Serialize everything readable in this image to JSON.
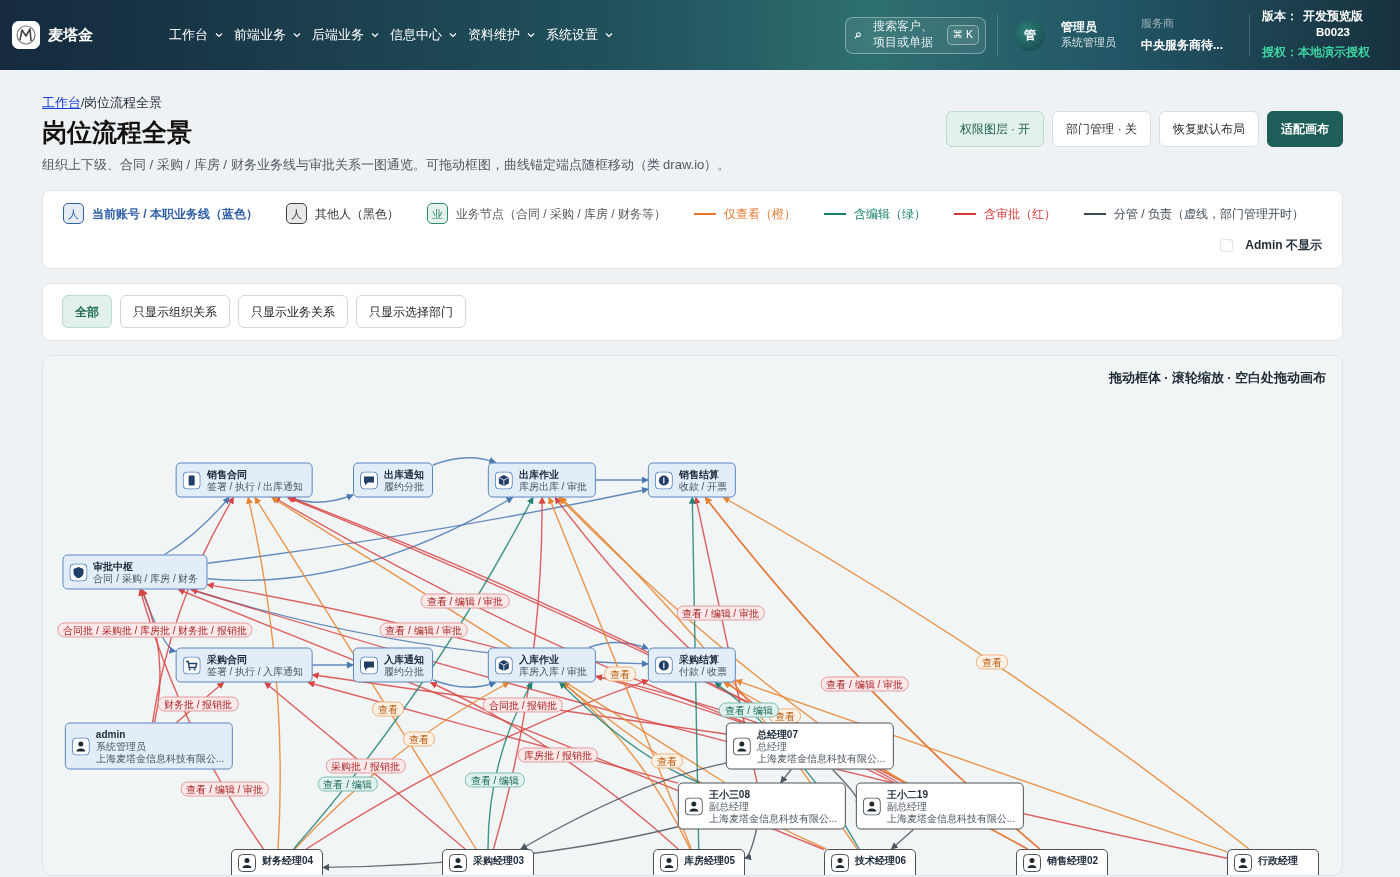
{
  "header": {
    "brand": "麦塔金",
    "nav": [
      {
        "label": "工作台"
      },
      {
        "label": "前端业务"
      },
      {
        "label": "后端业务"
      },
      {
        "label": "信息中心"
      },
      {
        "label": "资料维护"
      },
      {
        "label": "系统设置"
      }
    ],
    "search": {
      "placeholder": "搜索客户、项目或单据",
      "shortcut": "⌘ K"
    },
    "user": {
      "avatar": "管",
      "name": "管理员",
      "role": "系统管理员"
    },
    "provider": {
      "label": "服务商",
      "value": "中央服务商待..."
    },
    "version": {
      "label": "版本：",
      "value": "开发预览版 B0023"
    },
    "license": {
      "label": "授权：",
      "value": "本地演示授权"
    }
  },
  "page": {
    "breadcrumb": [
      {
        "label": "工作台",
        "link": true
      },
      {
        "label": "岗位流程全景",
        "link": false
      }
    ],
    "separator": "/",
    "title": "岗位流程全景",
    "description": "组织上下级、合同 / 采购 / 库房 / 财务业务线与审批关系一图通览。可拖动框图，曲线锚定端点随框移动（类 draw.io）。",
    "actions": [
      {
        "label": "权限图层 · 开",
        "kind": "soft"
      },
      {
        "label": "部门管理 · 关",
        "kind": "outline"
      },
      {
        "label": "恢复默认布局",
        "kind": "outline"
      },
      {
        "label": "适配画布",
        "kind": "primary"
      }
    ]
  },
  "legend": {
    "items": [
      {
        "kind": "chip",
        "icon": "人",
        "label": "当前账号 / 本职业务线（蓝色）",
        "color": "#2f5fa7"
      },
      {
        "kind": "chip",
        "icon": "人",
        "label": "其他人（黑色）",
        "color": "#3a3f45"
      },
      {
        "kind": "chip",
        "icon": "业",
        "label": "业务节点（合同 / 采购 / 库房 / 财务等）",
        "color": "#2a8a6e"
      },
      {
        "kind": "line",
        "label": "仅查看（橙）",
        "color": "#e8762c"
      },
      {
        "kind": "line",
        "label": "含编辑（绿）",
        "color": "#17806a"
      },
      {
        "kind": "line",
        "label": "含审批（红）",
        "color": "#d93636"
      },
      {
        "kind": "line",
        "label": "分管 / 负责（虚线，部门管理开时）",
        "color": "#3d4a55"
      }
    ],
    "admin_toggle": {
      "label": "Admin 不显示",
      "checked": false
    }
  },
  "filters": [
    {
      "label": "全部",
      "selected": true
    },
    {
      "label": "只显示组织关系",
      "selected": false
    },
    {
      "label": "只显示业务关系",
      "selected": false
    },
    {
      "label": "只显示选择部门",
      "selected": false
    }
  ],
  "canvas": {
    "hint": "拖动框体 · 滚轮缩放 · 空白处拖动画布",
    "nodes": [
      {
        "kind": "sales",
        "title": "销售合同",
        "lines": [
          "签署 / 执行 / 出库通知"
        ]
      },
      {
        "kind": "notice",
        "title": "出库通知",
        "lines": [
          "履约分批"
        ]
      },
      {
        "kind": "stock",
        "title": "出库作业",
        "lines": [
          "库房出库 / 审批"
        ]
      },
      {
        "kind": "settlement",
        "title": "销售结算",
        "lines": [
          "收款 / 开票"
        ]
      },
      {
        "kind": "hub",
        "title": "审批中枢",
        "lines": [
          "合同 / 采购 / 库房 / 财务"
        ]
      },
      {
        "kind": "purchase",
        "title": "采购合同",
        "lines": [
          "签署 / 执行 / 入库通知"
        ]
      },
      {
        "kind": "notice",
        "title": "入库通知",
        "lines": [
          "履约分批"
        ]
      },
      {
        "kind": "stock",
        "title": "入库作业",
        "lines": [
          "库房入库 / 审批"
        ]
      },
      {
        "kind": "settlement",
        "title": "采购结算",
        "lines": [
          "付款 / 收票"
        ]
      },
      {
        "kind": "self",
        "title": "admin",
        "lines": [
          "系统管理员",
          "上海麦塔金信息科技有限公..."
        ]
      },
      {
        "kind": "person",
        "title": "总经理07",
        "lines": [
          "总经理",
          "上海麦塔金信息科技有限公..."
        ]
      },
      {
        "kind": "person",
        "title": "王小三08",
        "lines": [
          "副总经理",
          "上海麦塔金信息科技有限公..."
        ]
      },
      {
        "kind": "person",
        "title": "王小二19",
        "lines": [
          "副总经理",
          "上海麦塔金信息科技有限公..."
        ]
      },
      {
        "kind": "person",
        "title": "财务经理04"
      },
      {
        "kind": "person",
        "title": "采购经理03"
      },
      {
        "kind": "person",
        "title": "库房经理05"
      },
      {
        "kind": "person",
        "title": "技术经理06"
      },
      {
        "kind": "person",
        "title": "销售经理02"
      },
      {
        "kind": "person",
        "title": "行政经理"
      }
    ],
    "edges": [
      {
        "kind": "org"
      },
      {
        "kind": "org"
      },
      {
        "kind": "org"
      },
      {
        "kind": "org"
      },
      {
        "kind": "org"
      },
      {
        "kind": "org"
      },
      {
        "kind": "org"
      },
      {
        "kind": "org"
      },
      {
        "kind": "org"
      },
      {
        "kind": "org"
      },
      {
        "kind": "org"
      },
      {
        "kind": "approve",
        "label": "合同批 / 采购批 / 库房批 / 财务批 / 报销批"
      },
      {
        "kind": "approve"
      },
      {
        "kind": "approve",
        "label": "财务批 / 报销批"
      },
      {
        "kind": "approve",
        "label": "查看 / 编辑 / 审批"
      },
      {
        "kind": "approve",
        "label": "查看 / 编辑 / 审批"
      },
      {
        "kind": "approve"
      },
      {
        "kind": "approve"
      },
      {
        "kind": "approve",
        "label": "查看 / 编辑 / 审批"
      },
      {
        "kind": "approve",
        "label": "采购批 / 报销批"
      },
      {
        "kind": "approve",
        "label": "库房批 / 报销批"
      },
      {
        "kind": "approve"
      },
      {
        "kind": "approve",
        "label": "查看 / 编辑 / 审批"
      },
      {
        "kind": "approve"
      },
      {
        "kind": "approve"
      },
      {
        "kind": "approve"
      },
      {
        "kind": "approve"
      },
      {
        "kind": "approve"
      },
      {
        "kind": "approve",
        "label": "合同批 / 报销批"
      },
      {
        "kind": "approve"
      },
      {
        "kind": "approve",
        "label": "查看 / 编辑 / 审批"
      },
      {
        "kind": "view",
        "label": "查看"
      },
      {
        "kind": "view"
      },
      {
        "kind": "view"
      },
      {
        "kind": "view",
        "label": "查看"
      },
      {
        "kind": "view"
      },
      {
        "kind": "view",
        "label": "查看"
      },
      {
        "kind": "view",
        "label": "查看"
      },
      {
        "kind": "view",
        "label": "查看"
      },
      {
        "kind": "view"
      },
      {
        "kind": "view"
      },
      {
        "kind": "view"
      },
      {
        "kind": "view",
        "label": "查看"
      },
      {
        "kind": "view"
      },
      {
        "kind": "edit",
        "label": "查看 / 编辑"
      },
      {
        "kind": "edit",
        "label": "查看 / 编辑"
      },
      {
        "kind": "edit"
      },
      {
        "kind": "edit",
        "label": "查看 / 编辑"
      },
      {
        "kind": "edit"
      },
      {
        "kind": "manage"
      },
      {
        "kind": "manage"
      },
      {
        "kind": "manage"
      },
      {
        "kind": "manage"
      },
      {
        "kind": "manage"
      },
      {
        "kind": "manage"
      }
    ]
  }
}
